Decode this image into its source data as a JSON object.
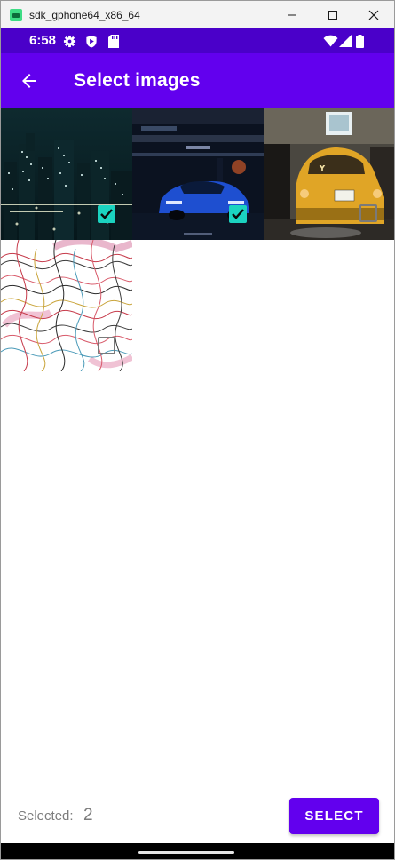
{
  "window": {
    "title": "sdk_gphone64_x86_64",
    "controls": [
      {
        "name": "minimize",
        "glyph": "—"
      },
      {
        "name": "maximize",
        "glyph": "☐"
      },
      {
        "name": "close",
        "glyph": "✕"
      }
    ]
  },
  "status_bar": {
    "time": "6:58",
    "icons": [
      "settings-icon",
      "shield-icon",
      "sd-card-icon",
      "wifi-icon",
      "signal-icon",
      "battery-icon"
    ]
  },
  "app_bar": {
    "title": "Select images",
    "back_icon": "arrow-back-icon"
  },
  "images": [
    {
      "name": "city-night",
      "selected": true
    },
    {
      "name": "blue-car",
      "selected": true
    },
    {
      "name": "yellow-car",
      "selected": false
    },
    {
      "name": "pattern",
      "selected": false
    }
  ],
  "footer": {
    "selected_label": "Selected:",
    "selected_count": "2",
    "select_button": "SELECT"
  },
  "colors": {
    "primary": "#6200ee",
    "status_bar": "#4a00c9",
    "checkbox_checked": "#1bd3c0"
  }
}
